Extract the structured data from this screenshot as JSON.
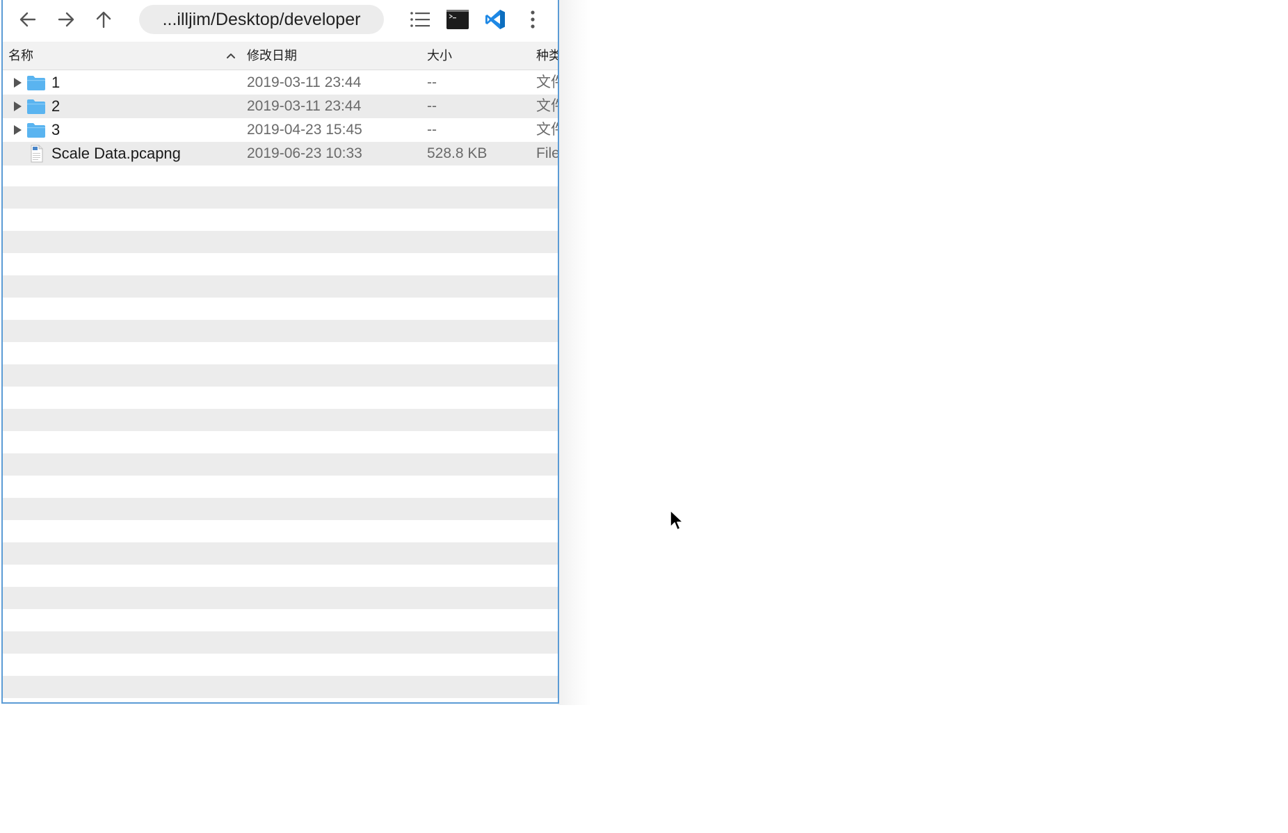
{
  "toolbar": {
    "back_icon": "arrow-left-icon",
    "forward_icon": "arrow-right-icon",
    "up_icon": "arrow-up-icon",
    "path": "...illjim/Desktop/developer",
    "list_view_icon": "list-icon",
    "terminal_icon": "terminal-icon",
    "vscode_icon": "vscode-icon",
    "more_icon": "more-vertical-icon"
  },
  "columns": {
    "name": "名称",
    "modified": "修改日期",
    "size": "大小",
    "kind": "种类"
  },
  "sort": {
    "column": "name",
    "direction": "ascending"
  },
  "files": [
    {
      "name": "1",
      "modified": "2019-03-11 23:44",
      "size": "--",
      "kind": "文件夹",
      "type": "folder"
    },
    {
      "name": "2",
      "modified": "2019-03-11 23:44",
      "size": "--",
      "kind": "文件夹",
      "type": "folder"
    },
    {
      "name": "3",
      "modified": "2019-04-23 15:45",
      "size": "--",
      "kind": "文件夹",
      "type": "folder"
    },
    {
      "name": "Scale Data.pcapng",
      "modified": "2019-06-23 10:33",
      "size": "528.8 KB",
      "kind": "File",
      "type": "file"
    }
  ],
  "colors": {
    "accent": "#1e88e5",
    "folder": "#5ab4f0",
    "window_border": "#5b9bd5"
  }
}
